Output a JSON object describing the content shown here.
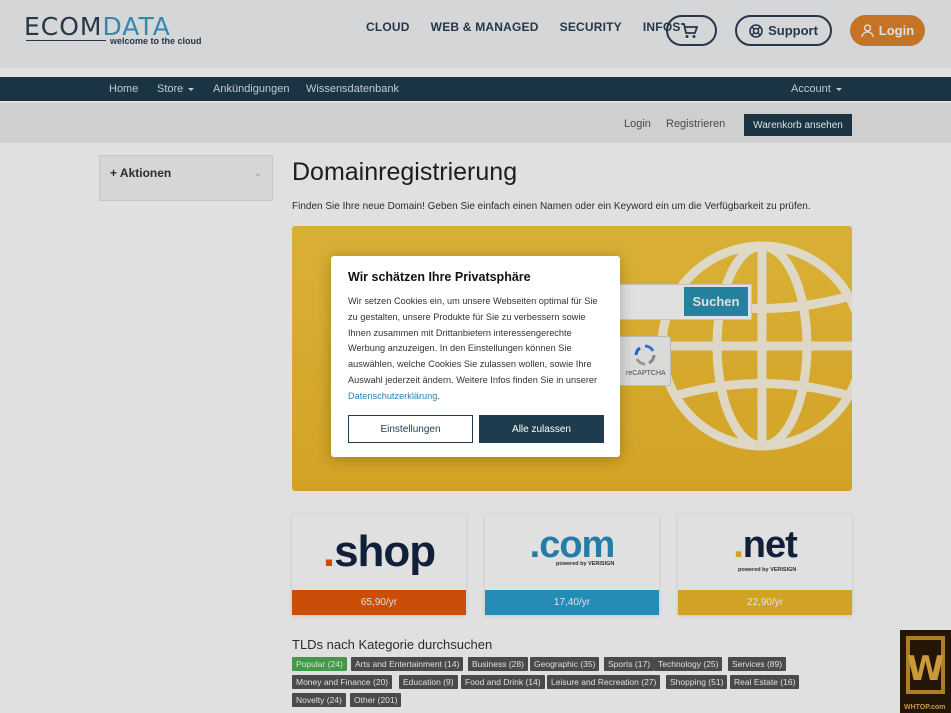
{
  "header": {
    "logo": {
      "brand_a": "ECOM",
      "brand_b": "DATA",
      "tagline": "welcome to the cloud"
    },
    "nav": [
      "CLOUD",
      "WEB & MANAGED",
      "SECURITY",
      "INFOS"
    ],
    "support_label": "Support",
    "login_label": "Login"
  },
  "subnav": {
    "home": "Home",
    "store": "Store",
    "announcements": "Ankündigungen",
    "knowledgebase": "Wissensdatenbank",
    "account": "Account"
  },
  "accountbar": {
    "login": "Login",
    "register": "Registrieren",
    "basket": "Warenkorb ansehen"
  },
  "sidebar": {
    "title": "Aktionen"
  },
  "main": {
    "title": "Domainregistrierung",
    "lead": "Finden Sie Ihre neue Domain! Geben Sie einfach einen Namen oder ein Keyword ein um die Verfügbarkeit zu prüfen.",
    "search_button": "Suchen",
    "captcha_label": "reCAPTCHA"
  },
  "modal": {
    "title": "Wir schätzen Ihre Privatsphäre",
    "body": "Wir setzen Cookies ein, um unsere Webseiten optimal für Sie zu gestalten, unsere Produkte für Sie zu verbessern sowie Ihnen zusammen mit Drittanbietern interessengerechte Werbung anzuzeigen. In den Einstellungen können Sie auswählen, welche Cookies Sie zulassen wollen, sowie Ihre Auswahl jederzeit ändern. Weitere Infos finden Sie in unserer ",
    "link": "Datenschutzerklärung",
    "body_end": ".",
    "settings_button": "Einstellungen",
    "allow_button": "Alle zulassen"
  },
  "tld_cards": [
    {
      "name": "shop",
      "price": "65,90/yr",
      "color": "#e8580a"
    },
    {
      "name": "com",
      "price": "17,40/yr",
      "color": "#2aa0d0",
      "powered": "powered by VERISIGN"
    },
    {
      "name": "net",
      "price": "22,90/yr",
      "color": "#f0b92a",
      "powered": "powered by VERISIGN"
    }
  ],
  "tld_section": {
    "heading": "TLDs nach Kategorie durchsuchen",
    "tags": [
      "Popular (24)",
      "Arts and Entertainment (14)",
      "Business (28)",
      "Geographic (35)",
      "Sports (17)",
      "Technology (25)",
      "Services (89)",
      "Money and Finance (20)",
      "Education (9)",
      "Food and Drink (14)",
      "Leisure and Recreation (27)",
      "Shopping (51)",
      "Real Estate (16)",
      "Novelty (24)",
      "Other (201)"
    ]
  },
  "watermark": {
    "text": "WHTOP.com"
  },
  "colors": {
    "primary": "#1e3c4d",
    "accent": "#e0852a",
    "search_bg": "#f0b92a",
    "link": "#2a7fb0"
  }
}
